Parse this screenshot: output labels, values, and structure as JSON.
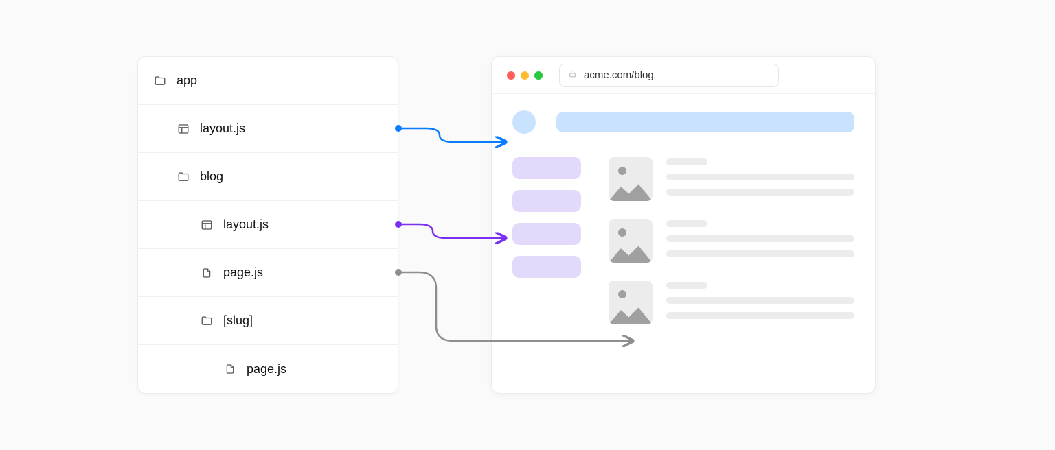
{
  "filetree": {
    "items": [
      {
        "type": "folder",
        "label": "app",
        "depth": 0
      },
      {
        "type": "layout",
        "label": "layout.js",
        "depth": 1
      },
      {
        "type": "folder",
        "label": "blog",
        "depth": 1
      },
      {
        "type": "layout",
        "label": "layout.js",
        "depth": 2
      },
      {
        "type": "file",
        "label": "page.js",
        "depth": 2
      },
      {
        "type": "folder",
        "label": "[slug]",
        "depth": 2
      },
      {
        "type": "file",
        "label": "page.js",
        "depth": 3
      }
    ]
  },
  "browser": {
    "traffic_lights": [
      "#ff5f57",
      "#febc2e",
      "#28c840"
    ],
    "url": "acme.com/blog"
  },
  "arrows": [
    {
      "from_row": 1,
      "color": "#0a7cff",
      "name": "root-layout-arrow",
      "target": "header"
    },
    {
      "from_row": 3,
      "color": "#7b2ff2",
      "name": "blog-layout-arrow",
      "target": "sidebar"
    },
    {
      "from_row": 4,
      "color": "#8e8e8e",
      "name": "blog-page-arrow",
      "target": "feed"
    }
  ],
  "colors": {
    "header_accent": "#c9e2ff",
    "sidebar_accent": "#e3d9fb",
    "placeholder": "#ececec",
    "placeholder_fg": "#a0a0a0"
  }
}
